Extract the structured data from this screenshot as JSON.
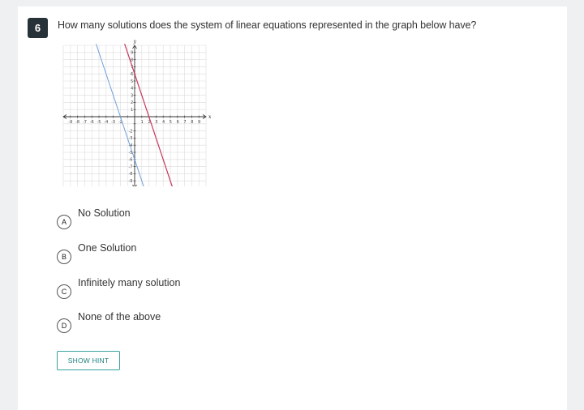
{
  "question": {
    "number": "6",
    "text": "How many solutions does the system of linear equations represented in the graph below have?"
  },
  "graph": {
    "x_axis_label": "x",
    "y_axis_label": "y",
    "x_ticks_neg": [
      "-9",
      "-8",
      "-7",
      "-6",
      "-5",
      "-4",
      "-3",
      "-2"
    ],
    "x_ticks_pos": [
      "1",
      "2",
      "3",
      "4",
      "5",
      "6",
      "7",
      "8",
      "9"
    ],
    "y_ticks_pos": [
      "9",
      "8",
      "7",
      "6",
      "5",
      "4",
      "3",
      "2",
      "1"
    ],
    "y_ticks_neg": [
      "-2",
      "-3",
      "-4",
      "-5",
      "-6",
      "-7",
      "-8",
      "-9"
    ],
    "line_colors": {
      "blue": "#6fa0d8",
      "red": "#c8375a"
    }
  },
  "options": [
    {
      "letter": "A",
      "label": "No Solution"
    },
    {
      "letter": "B",
      "label": "One Solution"
    },
    {
      "letter": "C",
      "label": "Infinitely many solution"
    },
    {
      "letter": "D",
      "label": "None of the above"
    }
  ],
  "hint_label": "SHOW HINT"
}
